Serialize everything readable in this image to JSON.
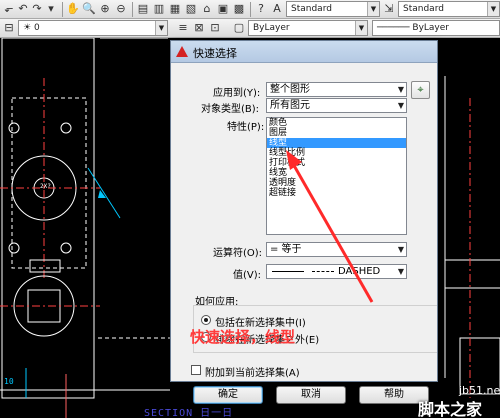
{
  "toolbar1": {
    "text_style": "Standard",
    "dim_style": "Standard",
    "layer_combo_prefix": "⊞",
    "linetype": "ByLayer",
    "lineweight": "ByLayer"
  },
  "toolbar2": {
    "layer_value": "0"
  },
  "drawing": {
    "section_label": "SECTION 日一日"
  },
  "dialog": {
    "title": "快速选择",
    "apply_to_label": "应用到(Y):",
    "apply_to_value": "整个图形",
    "object_type_label": "对象类型(B):",
    "object_type_value": "所有图元",
    "properties_label": "特性(P):",
    "properties": [
      {
        "label": "颜色"
      },
      {
        "label": "图层"
      },
      {
        "label": "线型"
      },
      {
        "label": "线型比例"
      },
      {
        "label": "打印样式"
      },
      {
        "label": "线宽"
      },
      {
        "label": "透明度"
      },
      {
        "label": "超链接"
      }
    ],
    "selected_property": 2,
    "operator_label": "运算符(O):",
    "operator_value": "= 等于",
    "value_label": "值(V):",
    "value_value": "DASHED",
    "how_to_apply_label": "如何应用:",
    "include_label": "包括在新选择集中(I)",
    "exclude_label": "排除在新选择集之外(E)",
    "append_label": "附加到当前选择集(A)",
    "ok_label": "确定",
    "cancel_label": "取消",
    "help_label": "帮助"
  },
  "annotation": {
    "text": "快速选择，线型"
  },
  "watermark": {
    "url": "jb51.net",
    "name": "脚本之家"
  }
}
